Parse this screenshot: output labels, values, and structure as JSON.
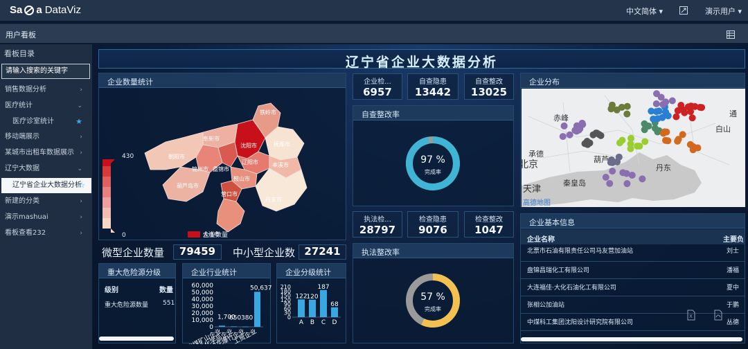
{
  "topbar": {
    "logo_text_a": "Sa",
    "logo_text_b": "a",
    "logo_text_c": "DataViz",
    "language": "中文简体 ▾",
    "user": "演示用户 ▾"
  },
  "subbar": {
    "title": "用户看板"
  },
  "sidebar": {
    "title": "看板目录",
    "search_placeholder": "请输入搜索的关键字",
    "items": [
      {
        "label": "销售数据分析",
        "arrow": "›"
      },
      {
        "label": "医疗统计",
        "arrow": "⌄"
      },
      {
        "label": "医疗诊室统计",
        "arrow": "★"
      },
      {
        "label": "移动端展示",
        "arrow": "›"
      },
      {
        "label": "某城市出租车数据展示",
        "arrow": "›"
      },
      {
        "label": "辽宁大数据",
        "arrow": "⌄"
      },
      {
        "label": "辽宁省企业大数据分析",
        "arrow": "☆"
      },
      {
        "label": "新建的分类",
        "arrow": "›"
      },
      {
        "label": "演示mashuai",
        "arrow": "›"
      },
      {
        "label": "看板查看232",
        "arrow": "›"
      }
    ]
  },
  "dashboard": {
    "title": "辽宁省企业大数据分析",
    "map_panel": {
      "title": "企业数量统计",
      "legend_max": "430",
      "legend_min": "0",
      "legend_series": "企业数量",
      "cities": [
        "铁岭市",
        "抚顺市",
        "沈阳市",
        "阜新市",
        "本溪市",
        "辽阳市",
        "鞍山市",
        "朝阳市",
        "锦州市",
        "盘锦市",
        "营口市",
        "葫芦岛市",
        "丹东市",
        "大连市"
      ]
    },
    "micro_label": "微型企业数量",
    "micro_value": "79459",
    "sme_label": "中小型企业数",
    "sme_value": "27241",
    "kpis_top": [
      {
        "label": "企业检...",
        "value": "6957"
      },
      {
        "label": "自查隐患",
        "value": "13442"
      },
      {
        "label": "自查整改",
        "value": "13025"
      }
    ],
    "self_rate": {
      "title": "自查整改率",
      "percent": "97 %",
      "caption": "完成率",
      "value": 0.97
    },
    "kpis_mid": [
      {
        "label": "执法检...",
        "value": "28797"
      },
      {
        "label": "检查隐患",
        "value": "9076"
      },
      {
        "label": "检查整改",
        "value": "1047"
      }
    ],
    "law_rate": {
      "title": "执法整改率",
      "percent": "57 %",
      "caption": "完成率",
      "value": 0.57
    },
    "risk_panel": {
      "title": "重大危险源分级",
      "col_level": "级别",
      "col_count": "数量",
      "row_label": "重大危险源数量",
      "row_value": "551"
    },
    "industry_panel": {
      "title": "企业行业统计"
    },
    "class_panel": {
      "title": "企业分级统计"
    },
    "geo_panel": {
      "title": "企业分布",
      "places": [
        "赤峰",
        "承德",
        "北京",
        "天津",
        "秦皇岛",
        "葫芦",
        "丹东",
        "白山",
        "通"
      ],
      "map_brand": "高德地图"
    },
    "info_panel": {
      "title": "企业基本信息",
      "col_name": "企业名称",
      "col_main": "主要负",
      "rows": [
        {
          "name": "北票市石油有限责任公司马友营加油站",
          "person": "刘士"
        },
        {
          "name": "盘锦昌瑞化工有限公司",
          "person": "潘福"
        },
        {
          "name": "大连福佳·大化石油化工有限公司",
          "person": "夏中"
        },
        {
          "name": "张相公加油站",
          "person": "于鹏"
        },
        {
          "name": "中煤科工集团沈阳设计研究院有限公司",
          "person": "丛德"
        }
      ]
    }
  },
  "chart_data": [
    {
      "type": "bar",
      "title": "企业行业统计",
      "categories": [
        "非煤矿山企业",
        "危险化学品企业",
        "烟花爆竹企业",
        "工贸企业"
      ],
      "values": [
        1700,
        650,
        380,
        50637
      ],
      "ylim": [
        0,
        60000
      ],
      "yticks": [
        "60,000",
        "50,000",
        "40,000",
        "30,000",
        "20,000",
        "10,000",
        "0"
      ],
      "data_labels": [
        "1,700",
        "650",
        "380",
        "50,637"
      ]
    },
    {
      "type": "bar",
      "title": "企业分级统计",
      "categories": [
        "A",
        "B",
        "C",
        "D"
      ],
      "values": [
        122,
        120,
        187,
        68
      ],
      "ylim": [
        0,
        210
      ],
      "yticks": [
        "210",
        "180",
        "150",
        "120",
        "90",
        "60",
        "30",
        "0"
      ]
    }
  ],
  "colors": {
    "accent": "#3fb4d4",
    "law_ring": "#f3c14f",
    "map_high": "#c8101a"
  }
}
